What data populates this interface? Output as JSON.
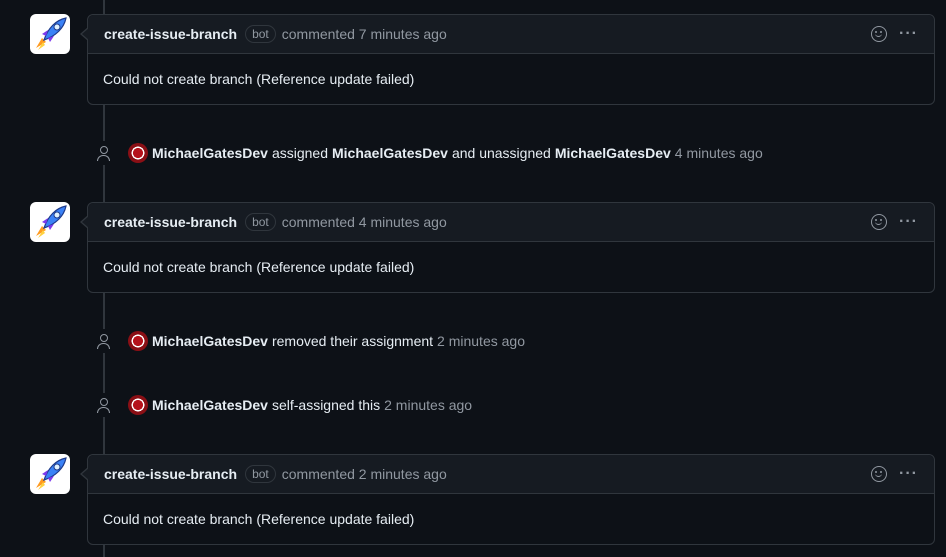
{
  "comments": [
    {
      "author": "create-issue-branch",
      "badge": "bot",
      "meta": "commented 7 minutes ago",
      "body": "Could not create branch (Reference update failed)"
    },
    {
      "author": "create-issue-branch",
      "badge": "bot",
      "meta": "commented 4 minutes ago",
      "body": "Could not create branch (Reference update failed)"
    },
    {
      "author": "create-issue-branch",
      "badge": "bot",
      "meta": "commented 2 minutes ago",
      "body": "Could not create branch (Reference update failed)"
    }
  ],
  "events": [
    {
      "actor": "MichaelGatesDev",
      "action": "assigned",
      "target": "MichaelGatesDev",
      "action2": "and unassigned",
      "target2": "MichaelGatesDev",
      "time": "4 minutes ago"
    },
    {
      "actor": "MichaelGatesDev",
      "action": "removed their assignment",
      "time": "2 minutes ago"
    },
    {
      "actor": "MichaelGatesDev",
      "action": "self-assigned this",
      "time": "2 minutes ago"
    }
  ],
  "icons": {
    "avatar": "rocket-icon",
    "reaction": "smiley-icon",
    "menu": "kebab-icon",
    "event": "person-icon"
  },
  "colors": {
    "background": "#0d1117",
    "header": "#161b22",
    "border": "#30363d",
    "muted": "#9198a1"
  }
}
